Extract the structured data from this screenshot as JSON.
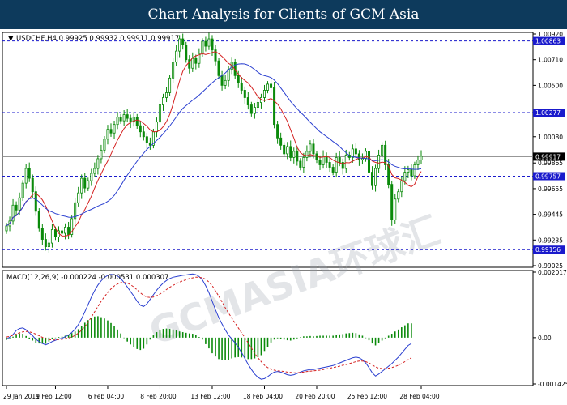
{
  "banner": {
    "title": "Chart Analysis for Clients of GCM Asia"
  },
  "watermark": "GCMASIA环球汇",
  "colors": {
    "frame": "#000000",
    "candle": "#0a8a0a",
    "ma_fast": "#d42020",
    "ma_slow": "#2a3fd0",
    "level_line": "#1a1acc",
    "level_box": "#1a1acc",
    "price_box": "#000000",
    "macd_hist": "#0a8a0a",
    "macd_line": "#2a3fd0",
    "signal_line": "#d42020"
  },
  "chart_data": [
    {
      "type": "candlestick",
      "symbol_info": "USDCHF,H4  0.99925 0.99932 0.99911 0.99917",
      "ylim": [
        0.99025,
        1.0092
      ],
      "y_ticks": [
        "1.00920",
        "1.00710",
        "1.00500",
        "1.00080",
        "0.99865",
        "0.99655",
        "0.99445",
        "0.99235",
        "0.99025"
      ],
      "levels": [
        {
          "label": "1.00863",
          "value": 1.00863,
          "style": "dashed"
        },
        {
          "label": "1.00277",
          "value": 1.00277,
          "style": "dashed"
        },
        {
          "label": "0.99917",
          "value": 0.99917,
          "style": "solid-current"
        },
        {
          "label": "0.99757",
          "value": 0.99757,
          "style": "dashed"
        },
        {
          "label": "0.99156",
          "value": 0.99156,
          "style": "dashed"
        }
      ],
      "close": [
        0.9935,
        0.9939,
        0.9952,
        0.9948,
        0.9958,
        0.997,
        0.9982,
        0.9974,
        0.9963,
        0.9947,
        0.9933,
        0.9924,
        0.9918,
        0.9921,
        0.9932,
        0.9926,
        0.9931,
        0.9929,
        0.9934,
        0.9928,
        0.9941,
        0.9954,
        0.9962,
        0.9974,
        0.9966,
        0.9972,
        0.9978,
        0.9982,
        0.999,
        0.9997,
        1.0006,
        1.0014,
        1.0011,
        1.0018,
        1.0024,
        1.0021,
        1.0026,
        1.0023,
        1.002,
        1.0024,
        1.0017,
        1.0012,
        1.0008,
        1.0003,
        1.0001,
        1.0012,
        1.002,
        1.0034,
        1.004,
        1.0044,
        1.0056,
        1.0069,
        1.0078,
        1.0088,
        1.0083,
        1.0071,
        1.0064,
        1.0072,
        1.0068,
        1.0076,
        1.0086,
        1.0082,
        1.0088,
        1.0079,
        1.007,
        1.0058,
        1.005,
        1.0054,
        1.0063,
        1.0069,
        1.0058,
        1.0052,
        1.0046,
        1.004,
        1.0034,
        1.0027,
        1.0032,
        1.0036,
        1.004,
        1.0046,
        1.0051,
        1.0048,
        1.0018,
        1.0007,
        1.0001,
        0.9994,
        1.0,
        0.9991,
        0.9996,
        0.9988,
        0.9983,
        0.9991,
        0.9996,
        1.0002,
        0.9994,
        0.9989,
        0.9985,
        0.9992,
        0.9987,
        0.9983,
        0.9979,
        0.9991,
        0.9987,
        0.9982,
        0.9993,
        0.9991,
        0.9998,
        0.9994,
        0.9989,
        0.999,
        0.9996,
        0.9979,
        0.9968,
        0.9982,
        0.9993,
        1.0001,
        0.9985,
        0.9969,
        0.994,
        0.9957,
        0.9963,
        0.9972,
        0.9979,
        0.9981,
        0.9976,
        0.9985,
        0.9989,
        0.9992
      ]
    },
    {
      "type": "line",
      "label": "MACD(12,26,9) -0.000224 -0.000531 0.000307",
      "ylim": [
        -0.001425,
        0.002017
      ],
      "y_ticks": [
        "0.002017",
        "0.00",
        "-0.001425"
      ],
      "macd": [
        -5e-05,
        2e-05,
        0.0001,
        0.00022,
        0.00028,
        0.0003,
        0.00024,
        0.00015,
        6e-05,
        -5e-05,
        -0.00012,
        -0.00018,
        -0.00022,
        -0.00018,
        -0.00012,
        -8e-05,
        -4e-05,
        -2e-05,
        3e-05,
        8e-05,
        0.00016,
        0.00026,
        0.0004,
        0.00058,
        0.0008,
        0.00102,
        0.00125,
        0.00145,
        0.00162,
        0.00175,
        0.00185,
        0.00192,
        0.00195,
        0.00194,
        0.0019,
        0.00182,
        0.0017,
        0.00156,
        0.00142,
        0.00128,
        0.00112,
        0.001,
        0.00096,
        0.00104,
        0.00118,
        0.00132,
        0.00146,
        0.00158,
        0.00168,
        0.00176,
        0.00182,
        0.00186,
        0.00188,
        0.0019,
        0.00192,
        0.00193,
        0.00195,
        0.00196,
        0.00194,
        0.00188,
        0.00178,
        0.0016,
        0.00138,
        0.00112,
        0.00086,
        0.00062,
        0.00042,
        0.00024,
        8e-05,
        -4e-05,
        -0.00016,
        -0.0003,
        -0.00046,
        -0.00064,
        -0.00082,
        -0.00098,
        -0.00112,
        -0.00122,
        -0.00128,
        -0.00126,
        -0.0012,
        -0.00112,
        -0.00106,
        -0.00104,
        -0.00106,
        -0.0011,
        -0.00114,
        -0.00116,
        -0.00114,
        -0.0011,
        -0.00106,
        -0.00102,
        -0.001,
        -0.00098,
        -0.00098,
        -0.00096,
        -0.00094,
        -0.00092,
        -0.0009,
        -0.00088,
        -0.00086,
        -0.00082,
        -0.00078,
        -0.00074,
        -0.0007,
        -0.00066,
        -0.00062,
        -0.0006,
        -0.00062,
        -0.00068,
        -0.00078,
        -0.00092,
        -0.00108,
        -0.00118,
        -0.00112,
        -0.00104,
        -0.00096,
        -0.00088,
        -0.0008,
        -0.0007,
        -0.0006,
        -0.00048,
        -0.00036,
        -0.00024,
        -0.00018
      ],
      "signal": [
        2e-05,
        4e-05,
        7e-05,
        0.00011,
        0.00015,
        0.00018,
        0.00019,
        0.00018,
        0.00015,
        0.00011,
        6e-05,
        1e-05,
        -3e-05,
        -6e-05,
        -7e-05,
        -7e-05,
        -6e-05,
        -5e-05,
        -3e-05,
        -1e-05,
        2e-05,
        7e-05,
        0.00014,
        0.00023,
        0.00034,
        0.00048,
        0.00063,
        0.0008,
        0.00096,
        0.00112,
        0.00126,
        0.00139,
        0.0015,
        0.00159,
        0.00165,
        0.00169,
        0.0017,
        0.00168,
        0.00163,
        0.00156,
        0.00147,
        0.00138,
        0.0013,
        0.00125,
        0.00124,
        0.00125,
        0.00129,
        0.00134,
        0.00141,
        0.00148,
        0.00155,
        0.00161,
        0.00166,
        0.00171,
        0.00175,
        0.00178,
        0.00182,
        0.00184,
        0.00186,
        0.00186,
        0.00184,
        0.0018,
        0.00171,
        0.0016,
        0.00144,
        0.00128,
        0.0011,
        0.00092,
        0.00076,
        0.0006,
        0.00045,
        0.0003,
        0.00015,
        0.0,
        -0.00016,
        -0.00032,
        -0.00048,
        -0.00062,
        -0.00074,
        -0.00085,
        -0.00092,
        -0.00097,
        -0.001,
        -0.00102,
        -0.00103,
        -0.00104,
        -0.00106,
        -0.00107,
        -0.00108,
        -0.00108,
        -0.00107,
        -0.00106,
        -0.00104,
        -0.00103,
        -0.00102,
        -0.00101,
        -0.001,
        -0.00098,
        -0.00096,
        -0.00094,
        -0.00092,
        -0.0009,
        -0.00088,
        -0.00085,
        -0.00083,
        -0.0008,
        -0.00077,
        -0.00074,
        -0.00072,
        -0.00072,
        -0.00074,
        -0.00078,
        -0.00084,
        -0.0009,
        -0.00094,
        -0.00095,
        -0.00095,
        -0.00094,
        -0.00092,
        -0.00089,
        -0.00085,
        -0.0008,
        -0.00074,
        -0.00068,
        -0.00062
      ],
      "hist": [
        -7e-05,
        -2e-05,
        3e-05,
        0.00011,
        0.00013,
        0.00012,
        5e-05,
        -3e-05,
        -9e-05,
        -0.00016,
        -0.00018,
        -0.00019,
        -0.00019,
        -0.00012,
        -5e-05,
        -1e-05,
        2e-05,
        3e-05,
        6e-05,
        9e-05,
        0.00014,
        0.00019,
        0.00026,
        0.00035,
        0.00046,
        0.00054,
        0.00062,
        0.00065,
        0.00066,
        0.00063,
        0.00059,
        0.00053,
        0.00045,
        0.00035,
        0.00025,
        0.00013,
        0.0,
        -0.00012,
        -0.00021,
        -0.00028,
        -0.00035,
        -0.00038,
        -0.00034,
        -0.00021,
        -6e-05,
        7e-05,
        0.00017,
        0.00024,
        0.00027,
        0.00028,
        0.00027,
        0.00025,
        0.00022,
        0.00019,
        0.00017,
        0.00015,
        0.00013,
        0.00012,
        8e-05,
        2e-05,
        -6e-05,
        -0.0002,
        -0.00033,
        -0.00048,
        -0.00058,
        -0.00066,
        -0.00068,
        -0.00068,
        -0.00068,
        -0.00064,
        -0.00061,
        -0.0006,
        -0.00061,
        -0.00064,
        -0.00066,
        -0.00066,
        -0.00064,
        -0.0006,
        -0.00054,
        -0.00041,
        -0.00028,
        -0.00015,
        -6e-05,
        -2e-05,
        -3e-05,
        -6e-05,
        -8e-05,
        -9e-05,
        -6e-05,
        -2e-05,
        1e-05,
        4e-05,
        4e-05,
        5e-05,
        4e-05,
        5e-05,
        6e-05,
        6e-05,
        6e-05,
        6e-05,
        6e-05,
        8e-05,
        0.0001,
        0.00011,
        0.00013,
        0.00014,
        0.00015,
        0.00014,
        0.0001,
        6e-05,
        0.0,
        -8e-05,
        -0.00018,
        -0.00024,
        -0.00017,
        -9e-05,
        -2e-05,
        6e-05,
        0.00012,
        0.00019,
        0.00025,
        0.00032,
        0.00038,
        0.00044,
        0.00044
      ]
    }
  ],
  "x_labels": [
    "29 Jan 2019",
    "1 Feb 12:00",
    "6 Feb 04:00",
    "8 Feb 20:00",
    "13 Feb 12:00",
    "18 Feb 04:00",
    "20 Feb 20:00",
    "25 Feb 12:00",
    "28 Feb 04:00"
  ]
}
